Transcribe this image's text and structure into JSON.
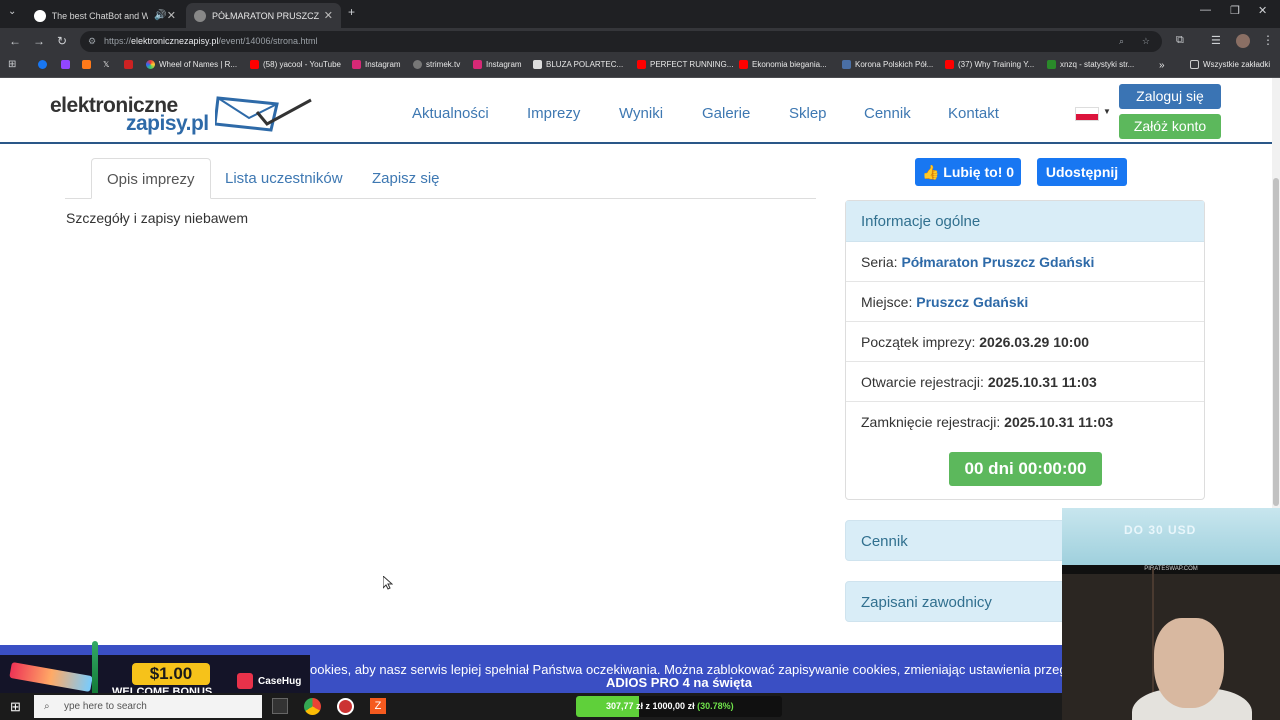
{
  "browser": {
    "tabs": [
      {
        "title": "The best ChatBot and Widg",
        "active": false
      },
      {
        "title": "PÓŁMARATON PRUSZCZ GDAŃ",
        "active": true
      }
    ],
    "url_prefix": "https://",
    "url_host": "elektronicznezapisy.pl",
    "url_path": "/event/14006/strona.html",
    "bookmarks": [
      "Wheel of Names | R...",
      "(58) yacool - YouTube",
      "Instagram",
      "strimek.tv",
      "Instagram",
      "BLUZA POLARTEC...",
      "PERFECT RUNNING...",
      "Ekonomia biegania...",
      "Korona Polskich Pół...",
      "(37) Why Training Y...",
      "xnzq - statystyki str..."
    ],
    "all_bookmarks": "Wszystkie zakładki"
  },
  "site": {
    "logo_line1": "elektroniczne",
    "logo_line2": "zapisy.pl",
    "nav": [
      "Aktualności",
      "Imprezy",
      "Wyniki",
      "Galerie",
      "Sklep",
      "Cennik",
      "Kontakt"
    ],
    "login": "Zaloguj się",
    "register": "Załóż konto"
  },
  "tabs": {
    "items": [
      "Opis imprezy",
      "Lista uczestników",
      "Zapisz się"
    ],
    "active_index": 0
  },
  "details_text": "Szczegóły i zapisy niebawem",
  "social": {
    "like": "Lubię to! 0",
    "share": "Udostępnij"
  },
  "info": {
    "heading": "Informacje ogólne",
    "rows": [
      {
        "label": "Seria:",
        "value": "Półmaraton Pruszcz Gdański"
      },
      {
        "label": "Miejsce:",
        "value": "Pruszcz Gdański"
      },
      {
        "label": "Początek imprezy:",
        "value": "2026.03.29 10:00"
      },
      {
        "label": "Otwarcie rejestracji:",
        "value": "2025.10.31 11:03"
      },
      {
        "label": "Zamknięcie rejestracji:",
        "value": "2025.10.31 11:03"
      }
    ],
    "countdown": "00 dni 00:00:00"
  },
  "sections": {
    "pricing": "Cennik",
    "registered": "Zapisani zawodnicy"
  },
  "cookie": {
    "text": "ookies, aby nasz serwis lepiej spełniał Państwa oczekiwania. Można zablokować zapisywanie cookies, zmieniając ustawienia przeglądar",
    "promo": "ADIOS PRO 4 na święta"
  },
  "ad": {
    "amount": "$1.00",
    "bonus": "WELCOME BONUS",
    "brand": "CaseHug"
  },
  "taskbar": {
    "search_placeholder": "ype here to search",
    "stream_amount": "307,77 zł z 1000,00 zł",
    "stream_percent": "(30.78%)",
    "stream_progress": 0.3078
  },
  "webcam": {
    "promo": "DO 30 USD",
    "site": "PIRATESWAP.COM"
  },
  "colors": {
    "link": "#3e78b2",
    "primary": "#3a74b4",
    "success": "#5cb85c",
    "facebook": "#1877f2",
    "info_bg": "#d9edf7",
    "cookie_bg": "#3a4fc4"
  }
}
